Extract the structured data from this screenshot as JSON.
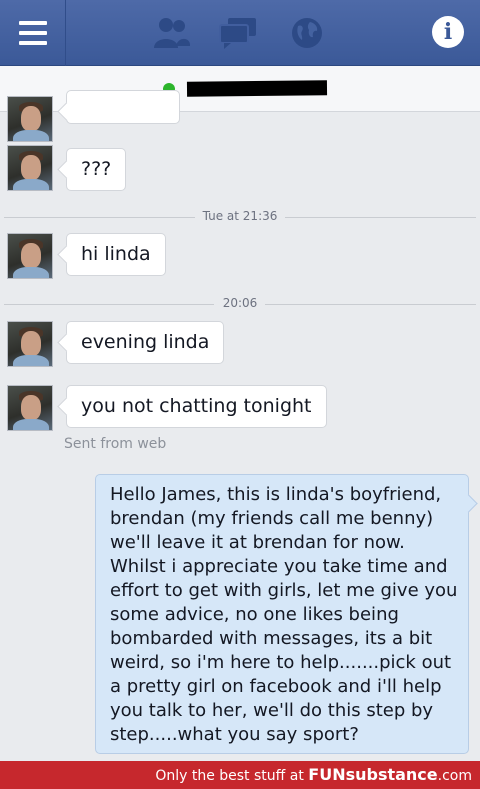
{
  "header": {
    "menu_icon": "hamburger-menu-icon",
    "friends_icon": "friends-icon",
    "messages_icon": "messages-icon",
    "globe_icon": "globe-icon",
    "info_icon_glyph": "i",
    "brand_color": "#3b5998"
  },
  "conversation": {
    "contact_status": "online",
    "online_color": "#2cb52c"
  },
  "messages": {
    "m1": "???",
    "divider1": "Tue at 21:36",
    "m2": "hi linda",
    "divider2": "20:06",
    "m3": "evening linda",
    "m4": "you not chatting tonight",
    "sent_from": "Sent from web",
    "reply": "Hello James, this is linda's boyfriend, brendan (my friends call me benny) we'll leave it at brendan for now. Whilst i appreciate you take time and effort to get with girls, let me give you some advice, no one likes being bombarded with messages, its a bit weird, so i'm here to help.......pick out a pretty girl on facebook and i'll help you talk to her, we'll do this step by step.....what you say sport?"
  },
  "footer": {
    "tagline": "Only the best stuff at",
    "brand": "FUNsubstance",
    "domain": ".com",
    "color": "#c6282d"
  }
}
